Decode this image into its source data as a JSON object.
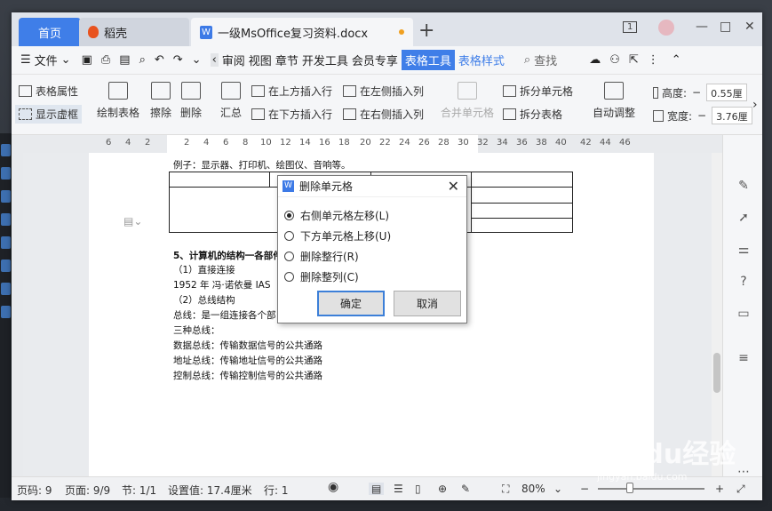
{
  "tabs": {
    "home": "首页",
    "daoke": "稻壳",
    "doc": "一级MsOffice复习资料.docx",
    "new_tab": "+"
  },
  "window_controls": {
    "badge": "1",
    "minimize": "—",
    "maximize": "□",
    "close": "✕"
  },
  "menu": {
    "file": "文件",
    "items": [
      "审阅",
      "视图",
      "章节",
      "开发工具",
      "会员专享"
    ],
    "active": "表格工具",
    "secondary": "表格样式",
    "search": "查找"
  },
  "ribbon": {
    "table_props": "表格属性",
    "show_grid": "显示虚框",
    "draw_table": "绘制表格",
    "erase": "擦除",
    "delete": "删除",
    "summary": "汇总",
    "insert_above": "在上方插入行",
    "insert_below": "在下方插入行",
    "insert_left": "在左侧插入列",
    "insert_right": "在右侧插入列",
    "merge": "合并单元格",
    "split_cell": "拆分单元格",
    "split_table": "拆分表格",
    "auto_adjust": "自动调整",
    "height_label": "高度:",
    "height_value": "0.55厘",
    "width_label": "宽度:",
    "width_value": "3.76厘"
  },
  "ruler_ticks": [
    "6",
    "4",
    "2",
    "2",
    "4",
    "6",
    "8",
    "10",
    "12",
    "14",
    "16",
    "18",
    "20",
    "22",
    "24",
    "26",
    "28",
    "30",
    "32",
    "34",
    "36",
    "38",
    "40",
    "42",
    "44",
    "46"
  ],
  "document": {
    "line1": "例子：显示器、打印机、绘图仪、音响等。",
    "heading": "5、计算机的结构一各部件",
    "sub1": "（1）直接连接",
    "line_1952": "1952 年 冯·诺依曼 IAS",
    "sub2": "（2）总线结构",
    "bus_def": "总线：是一组连接各个部",
    "three_bus": "三种总线：",
    "data_bus": "数据总线：传输数据信号的公共通路",
    "addr_bus": "地址总线：传输地址信号的公共通路",
    "ctrl_bus": "控制总线：传输控制信号的公共通路"
  },
  "dialog": {
    "title": "删除单元格",
    "options": [
      "右侧单元格左移(L)",
      "下方单元格上移(U)",
      "删除整行(R)",
      "删除整列(C)"
    ],
    "selected_index": 0,
    "ok": "确定",
    "cancel": "取消"
  },
  "status": {
    "page_code": "页码: 9",
    "pages": "页面: 9/9",
    "section": "节: 1/1",
    "setting": "设置值: 17.4厘米",
    "row": "行: 1",
    "zoom": "80%"
  },
  "watermark": {
    "brand": "Baidu经验",
    "url": "jingyan.baidu.com"
  },
  "colors": {
    "accent": "#3f7ee8",
    "dialog_ok_border": "#3c7fd8"
  }
}
